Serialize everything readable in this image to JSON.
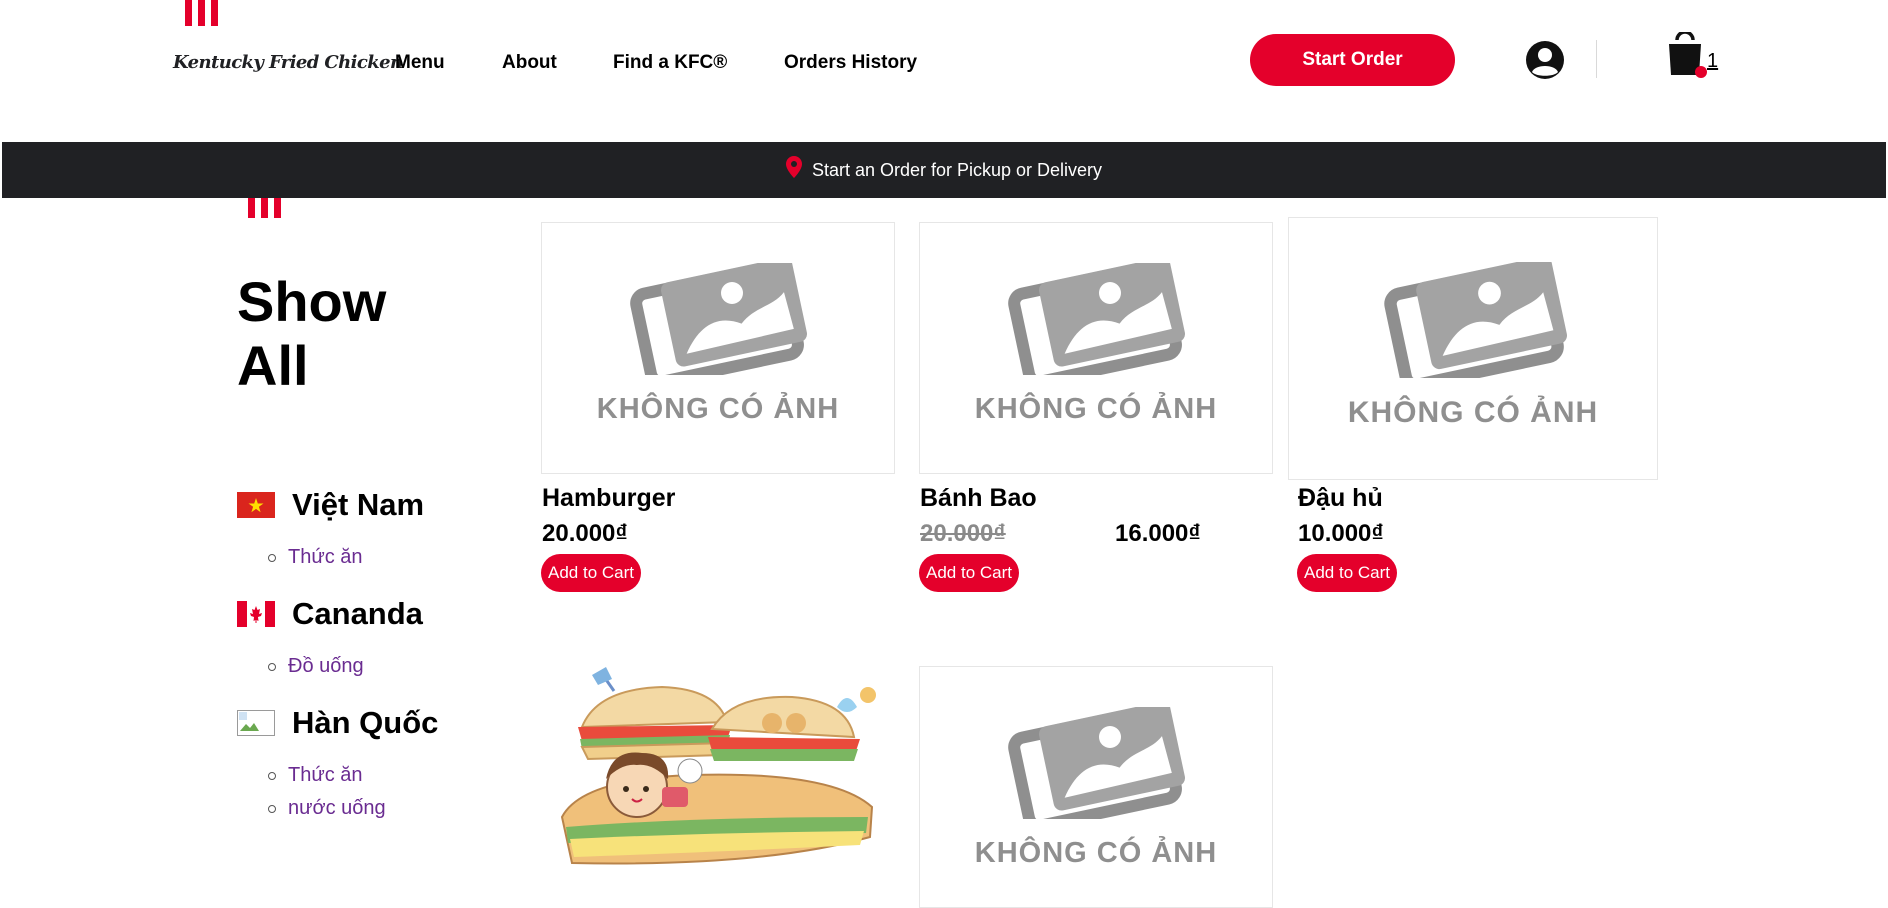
{
  "header": {
    "brand_name": "Kentucky Fried Chicken",
    "nav": [
      {
        "label": "Menu"
      },
      {
        "label": "About"
      },
      {
        "label": "Find a KFC®"
      },
      {
        "label": "Orders History"
      }
    ],
    "start_order_label": "Start Order",
    "cart_count": "1",
    "accent_color": "#e4002b"
  },
  "order_bar": {
    "text": "Start an Order for Pickup or Delivery",
    "icon": "map-pin-icon",
    "background": "#202124"
  },
  "sidebar": {
    "title": "Show All",
    "countries": [
      {
        "name": "Việt Nam",
        "flag": "vietnam-flag-icon",
        "categories": [
          "Thức ăn"
        ]
      },
      {
        "name": "Cananda",
        "flag": "canada-flag-icon",
        "categories": [
          "Đồ uống"
        ]
      },
      {
        "name": "Hàn Quốc",
        "flag": "broken-image-icon",
        "categories": [
          "Thức ăn",
          "nước uống"
        ]
      }
    ]
  },
  "products": [
    {
      "name": "Hamburger",
      "price": "20.000₫",
      "image_text": "KHÔNG CÓ ẢNH",
      "button": "Add to Cart"
    },
    {
      "name": "Bánh Bao",
      "old_price": "20.000₫",
      "price": "16.000₫",
      "image_text": "KHÔNG CÓ ẢNH",
      "button": "Add to Cart"
    },
    {
      "name": "Đậu hủ",
      "price": "10.000₫",
      "image_text": "KHÔNG CÓ ẢNH",
      "button": "Add to Cart"
    },
    {
      "image": "sandwich-illustration"
    },
    {
      "image_text": "KHÔNG CÓ ẢNH"
    }
  ]
}
